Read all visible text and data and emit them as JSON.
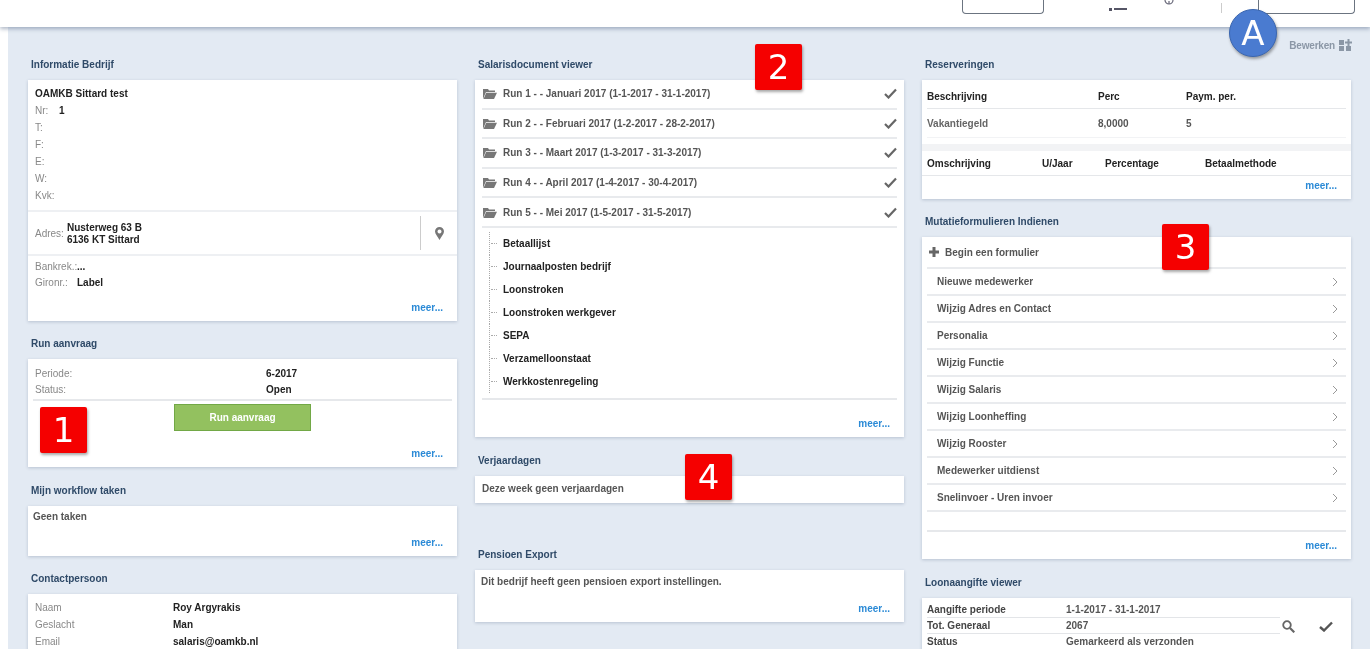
{
  "toolbar": {
    "edit_label": "Bewerken"
  },
  "callouts": [
    {
      "kind": "circle",
      "label": "A"
    },
    {
      "kind": "square",
      "label": "1"
    },
    {
      "kind": "square",
      "label": "2"
    },
    {
      "kind": "square",
      "label": "3"
    },
    {
      "kind": "square",
      "label": "4"
    }
  ],
  "company": {
    "title": "Informatie Bedrijf",
    "name": "OAMKB Sittard test",
    "fields": [
      {
        "label": "Nr:",
        "value": "1"
      },
      {
        "label": "T:"
      },
      {
        "label": "F:"
      },
      {
        "label": "E:"
      },
      {
        "label": "W:"
      },
      {
        "label": "Kvk:"
      }
    ],
    "address": {
      "label": "Adres:",
      "lines": [
        "Nusterweg 63 B",
        "6136 KT Sittard"
      ]
    },
    "bank": [
      {
        "label": "Bankrek.:",
        "value": "..."
      },
      {
        "label": "Gironr.:",
        "value": "Label"
      }
    ],
    "more": "meer..."
  },
  "run_request": {
    "title": "Run aanvraag",
    "rows": [
      {
        "label": "Periode:",
        "value": "6-2017"
      },
      {
        "label": "Status:",
        "value": "Open"
      }
    ],
    "button": "Run aanvraag",
    "more": "meer..."
  },
  "workflow": {
    "title": "Mijn workflow taken",
    "text": "Geen taken",
    "more": "meer..."
  },
  "contact": {
    "title": "Contactpersoon",
    "rows": [
      {
        "label": "Naam",
        "value": "Roy Argyrakis"
      },
      {
        "label": "Geslacht",
        "value": "Man"
      },
      {
        "label": "Email",
        "value": "salaris@oamkb.nl"
      }
    ]
  },
  "salary_viewer": {
    "title": "Salarisdocument viewer",
    "runs": [
      {
        "label": "Run 1 - - Januari 2017 (1-1-2017 - 31-1-2017)",
        "done": true
      },
      {
        "label": "Run 2 - - Februari 2017 (1-2-2017 - 28-2-2017)",
        "done": true
      },
      {
        "label": "Run 3 - - Maart 2017 (1-3-2017 - 31-3-2017)",
        "done": true
      },
      {
        "label": "Run 4 - - April 2017 (1-4-2017 - 30-4-2017)",
        "done": true
      },
      {
        "label": "Run 5 - - Mei 2017 (1-5-2017 - 31-5-2017)",
        "done": true,
        "children": [
          {
            "label": "Betaallijst"
          },
          {
            "label": "Journaalposten bedrijf"
          },
          {
            "label": "Loonstroken"
          },
          {
            "label": "Loonstroken werkgever"
          },
          {
            "label": "SEPA"
          },
          {
            "label": "Verzamelloonstaat"
          },
          {
            "label": "Werkkostenregeling"
          }
        ]
      }
    ],
    "more": "meer..."
  },
  "birthdays": {
    "title": "Verjaardagen",
    "text": "Deze week geen verjaardagen"
  },
  "pension": {
    "title": "Pensioen Export",
    "text": "Dit bedrijf heeft geen pensioen export instellingen.",
    "more": "meer..."
  },
  "reservations": {
    "title": "Reserveringen",
    "table_1": {
      "columns": [
        "Beschrijving",
        "Perc",
        "Paym. per."
      ],
      "rows": [
        [
          "Vakantiegeld",
          "8,0000",
          "5"
        ]
      ]
    },
    "table_2": {
      "columns": [
        "Omschrijving",
        "U/Jaar",
        "Percentage",
        "Betaalmethode"
      ]
    },
    "more": "meer..."
  },
  "mutation_forms": {
    "title": "Mutatieformulieren Indienen",
    "start": "Begin een formulier",
    "items": [
      "Nieuwe medewerker",
      "Wijzig Adres en Contact",
      "Personalia",
      "Wijzig Functie",
      "Wijzig Salaris",
      "Wijzig Loonheffing",
      "Wijzig Rooster",
      "Medewerker uitdienst",
      "Snelinvoer - Uren invoer"
    ],
    "more": "meer..."
  },
  "tax_viewer": {
    "title": "Loonaangifte viewer",
    "rows": [
      {
        "label": "Aangifte periode",
        "value": "1-1-2017 - 31-1-2017"
      },
      {
        "label": "Tot. Generaal",
        "value": "2067"
      },
      {
        "label": "Status",
        "value": "Gemarkeerd als verzonden"
      }
    ]
  }
}
